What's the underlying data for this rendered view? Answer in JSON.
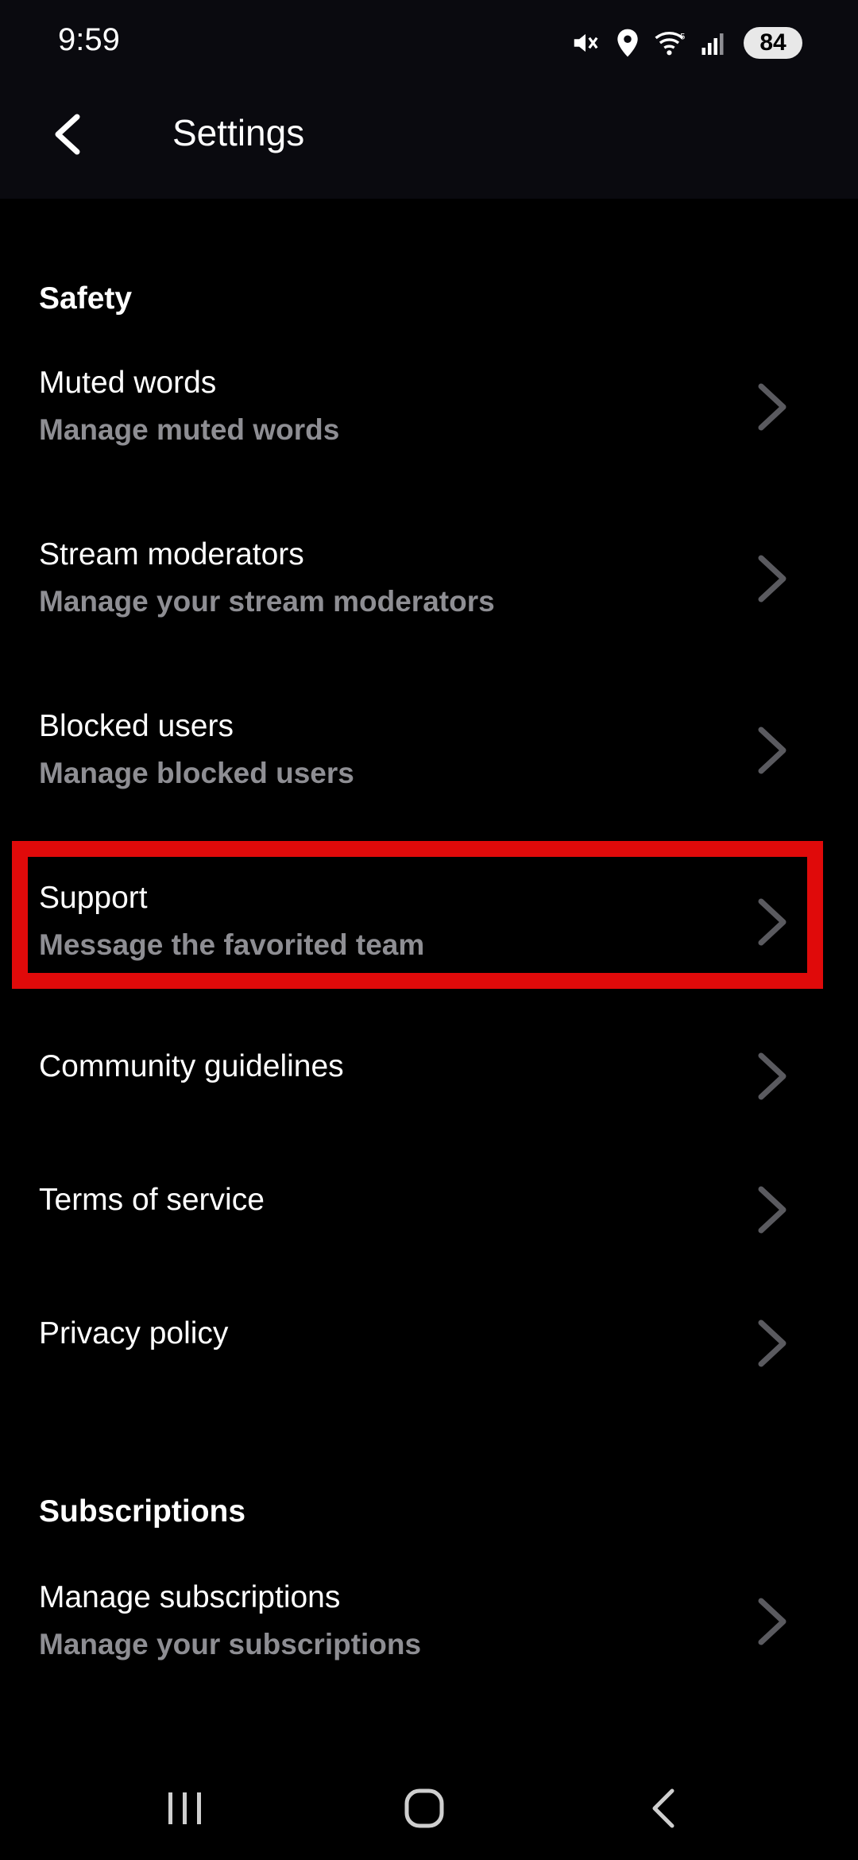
{
  "status_bar": {
    "time": "9:59",
    "battery": "84",
    "icons": [
      "mute-icon",
      "location-icon",
      "wifi-icon",
      "signal-icon"
    ]
  },
  "app_bar": {
    "title": "Settings",
    "back_icon": "back-arrow-icon"
  },
  "sections": {
    "safety": {
      "header": "Safety",
      "items": [
        {
          "title": "Muted words",
          "subtitle": "Manage muted words"
        },
        {
          "title": "Stream moderators",
          "subtitle": "Manage your stream moderators"
        },
        {
          "title": "Blocked users",
          "subtitle": "Manage blocked users"
        },
        {
          "title": "Support",
          "subtitle": "Message the favorited team"
        },
        {
          "title": "Community guidelines"
        },
        {
          "title": "Terms of service"
        },
        {
          "title": "Privacy policy"
        }
      ]
    },
    "subscriptions": {
      "header": "Subscriptions",
      "items": [
        {
          "title": "Manage subscriptions",
          "subtitle": "Manage your subscriptions"
        }
      ]
    }
  },
  "highlight": {
    "target": "Support",
    "color": "#e00a0a"
  },
  "nav_bar": {
    "icons": [
      "recents-icon",
      "home-icon",
      "back-icon"
    ]
  },
  "colors": {
    "background": "#000000",
    "app_bar": "#0a0a0f",
    "text_primary": "#ffffff",
    "text_secondary": "#8e8e93",
    "chevron": "#5a5a5f"
  }
}
